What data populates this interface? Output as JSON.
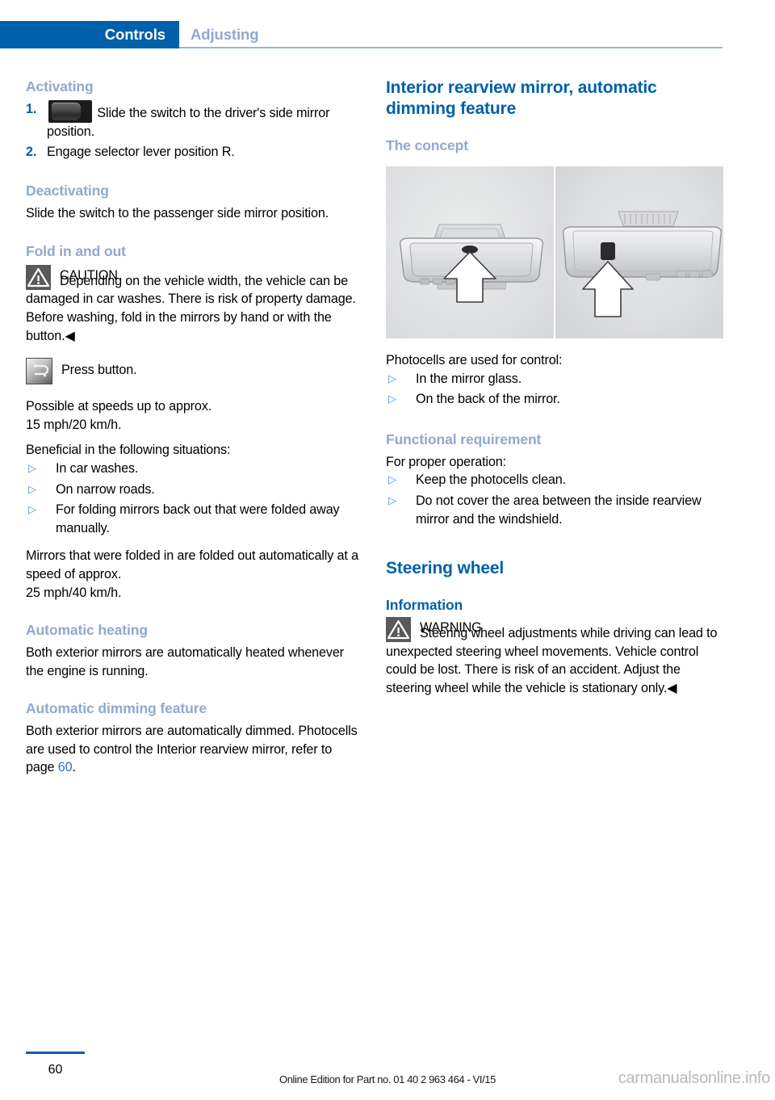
{
  "header": {
    "active_tab": "Controls",
    "inactive_tab": "Adjusting",
    "accent_color": "#0060A9",
    "muted_color": "#8FA9CF"
  },
  "left_column": {
    "activating": {
      "heading": "Activating",
      "steps": [
        {
          "num": "1.",
          "icon": "rocker-switch-icon",
          "text": "Slide the switch to the driver's side mirror position."
        },
        {
          "num": "2.",
          "text": "Engage selector lever position R."
        }
      ]
    },
    "deactivating": {
      "heading": "Deactivating",
      "text": "Slide the switch to the passenger side mirror position."
    },
    "fold_in_and_out": {
      "heading": "Fold in and out",
      "caution_title": "CAUTION",
      "caution_text": "Depending on the vehicle width, the vehicle can be damaged in car washes. There is risk of property damage. Before washing, fold in the mirrors by hand or with the button.◀",
      "button_label": "Press button.",
      "speed_note_line1": "Possible at speeds up to approx.",
      "speed_note_line2": "15 mph/20 km/h.",
      "situations_intro": "Beneficial in the following situations:",
      "situations": [
        "In car washes.",
        "On narrow roads.",
        "For folding mirrors back out that were folded away manually."
      ],
      "unfold_note_line1": "Mirrors that were folded in are folded out automatically at a speed of approx.",
      "unfold_note_line2": "25 mph/40 km/h."
    },
    "automatic_heating": {
      "heading": "Automatic heating",
      "text": "Both exterior mirrors are automatically heated whenever the engine is running."
    },
    "automatic_dimming": {
      "heading": "Automatic dimming feature",
      "text_part1": "Both exterior mirrors are automatically dimmed. Photocells are used to control the Interior rearview mirror, refer to page ",
      "page_ref": "60",
      "text_part2": "."
    }
  },
  "right_column": {
    "interior_mirror": {
      "title": "Interior rearview mirror, automatic dimming feature",
      "concept_heading": "The concept",
      "figure_caption_intro": "Photocells are used for control:",
      "photocell_locations": [
        "In the mirror glass.",
        "On the back of the mirror."
      ],
      "functional_requirement_heading": "Functional requirement",
      "functional_intro": "For proper operation:",
      "functional_items": [
        "Keep the photocells clean.",
        "Do not cover the area between the inside rearview mirror and the windshield."
      ]
    },
    "steering_wheel": {
      "title": "Steering wheel",
      "information_heading": "Information",
      "warning_title": "WARNING",
      "warning_text": "Steering wheel adjustments while driving can lead to unexpected steering wheel movements. Vehicle control could be lost. There is risk of an accident. Adjust the steering wheel while the vehicle is stationary only.◀"
    }
  },
  "footer": {
    "page_number": "60",
    "edition_note": "Online Edition for Part no. 01 40 2 963 464 - VI/15",
    "watermark": "carmanualsonline.info"
  }
}
